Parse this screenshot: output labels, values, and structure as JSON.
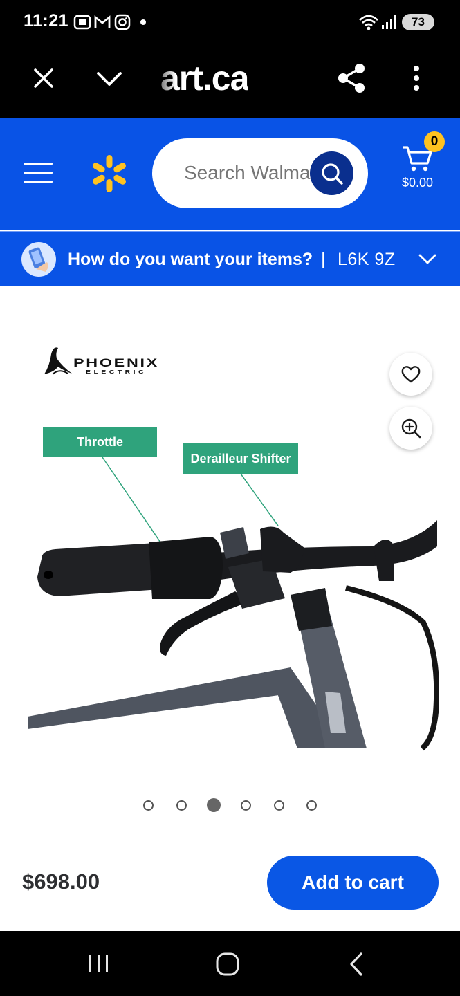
{
  "status_bar": {
    "time": "11:21",
    "notification_icons": [
      "screenshot-icon",
      "gmail-icon",
      "instagram-icon",
      "dot-icon"
    ],
    "system_icons": [
      "wifi-icon",
      "signal-icon"
    ],
    "battery": "73"
  },
  "browser": {
    "url": "art.ca",
    "icons": [
      "close-icon",
      "chevron-down-icon",
      "share-icon",
      "more-vert-icon"
    ]
  },
  "header": {
    "search_placeholder": "Search Walmart",
    "cart_count": "0",
    "cart_total": "$0.00",
    "colors": {
      "brand_blue": "#0953e6",
      "spark_yellow": "#ffc220",
      "search_button": "#0a2f8e"
    }
  },
  "delivery": {
    "question": "How do you want your items?",
    "separator": "|",
    "postal_code": "L6K 9Z"
  },
  "product_image": {
    "brand_logo_text": "PHOENIX ELECTRIC",
    "callouts": [
      "Throttle",
      "Derailleur Shifter"
    ],
    "callout_color": "#2fa37c"
  },
  "carousel": {
    "total": 6,
    "active_index": 2
  },
  "buy_bar": {
    "price": "$698.00",
    "add_to_cart_label": "Add to cart",
    "button_color": "#0a57e5"
  },
  "nav_bar": {
    "icons": [
      "recents-icon",
      "home-icon",
      "back-icon"
    ]
  }
}
